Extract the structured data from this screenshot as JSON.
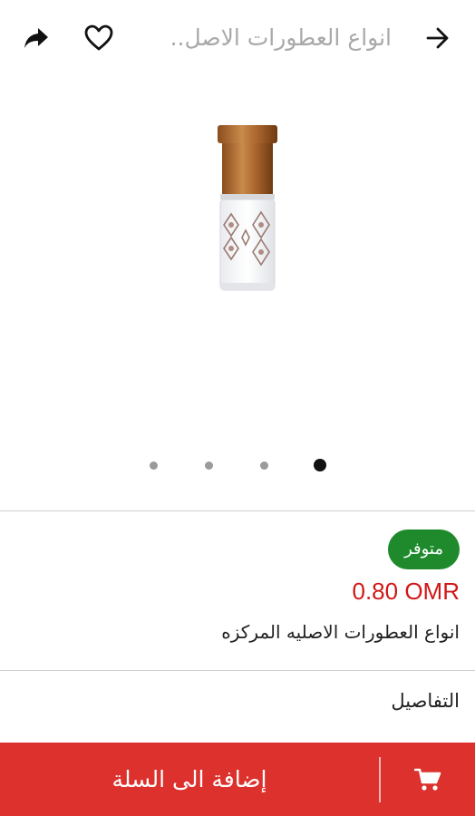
{
  "header": {
    "title": "انواع العطورات الاصل..",
    "icons": {
      "share": "share-icon",
      "favorite": "heart-outline-icon",
      "back": "arrow-right-icon"
    }
  },
  "gallery": {
    "image": "perfume-oil-bottle",
    "page_count": 4,
    "active_page": 4
  },
  "product": {
    "availability": "متوفر",
    "price": "0.80 OMR",
    "name": "انواع العطورات الاصليه المركزه",
    "details_label": "التفاصيل"
  },
  "bottom_bar": {
    "add_to_cart_label": "إضافة الى السلة",
    "cart_icon": "shopping-cart-icon"
  },
  "colors": {
    "price_red": "#d01818",
    "availability_green": "#1e8a2c",
    "bar_red": "#dc312c"
  }
}
